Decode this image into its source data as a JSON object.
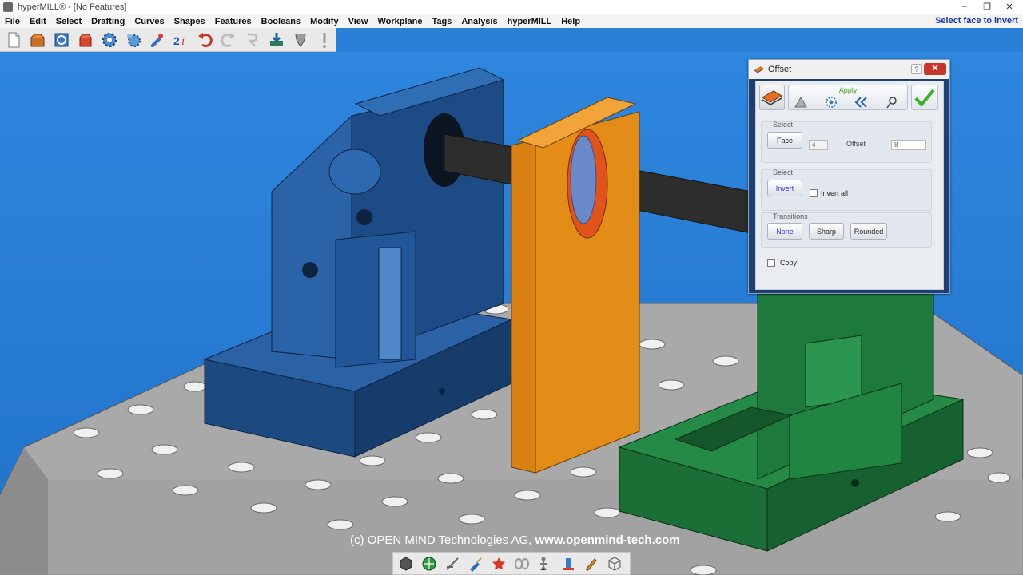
{
  "window": {
    "title": "hyperMILL® - [No Features]",
    "controls": {
      "minimize": "–",
      "restore": "❐",
      "close": "✕"
    }
  },
  "menu": {
    "items": [
      "File",
      "Edit",
      "Select",
      "Drafting",
      "Curves",
      "Shapes",
      "Features",
      "Booleans",
      "Modify",
      "View",
      "Workplane",
      "Tags",
      "Analysis",
      "hyperMILL",
      "Help"
    ],
    "status_text": "Select face to invert"
  },
  "toolbar": {
    "icons": [
      "new-file-icon",
      "open-box-icon",
      "save-refresh-icon",
      "delete-box-icon",
      "gear-blue-icon",
      "gear-settings-icon",
      "paint-pen-icon",
      "info-2i-icon",
      "undo-icon",
      "redo-icon",
      "rebuild-icon",
      "import-icon",
      "tool-icon",
      "warning-icon"
    ]
  },
  "dialog": {
    "title": "Offset",
    "help": "?",
    "close": "✕",
    "apply_label": "Apply",
    "select_face": {
      "label": "Select",
      "face_button": "Face",
      "count_value": "4",
      "offset_label": "Offset",
      "offset_value": "8"
    },
    "select_invert": {
      "label": "Select",
      "invert_button": "Invert",
      "invert_all_label": "Invert all"
    },
    "transitions": {
      "label": "Transitions",
      "options": [
        "None",
        "Sharp",
        "Rounded"
      ],
      "active": "None"
    },
    "copy_label": "Copy"
  },
  "footer": {
    "copyright": "(c) OPEN MIND Technologies AG,",
    "url": "www.openmind-tech.com"
  },
  "bottom_toolbar": {
    "icons": [
      "view-cube-icon",
      "sphere-icon",
      "line-edit-icon",
      "brush-icon",
      "star-icon",
      "oo-icon",
      "figure-icon",
      "tower-icon",
      "pencil-icon",
      "wireframe-icon"
    ]
  },
  "colors": {
    "viewport_blue": "#2a7fd6",
    "part_blue": "#1e4f8a",
    "part_orange": "#e08a12",
    "part_green": "#1f7a3c",
    "table_gray": "#a8a8a8",
    "status_blue": "#1a3aa8"
  }
}
